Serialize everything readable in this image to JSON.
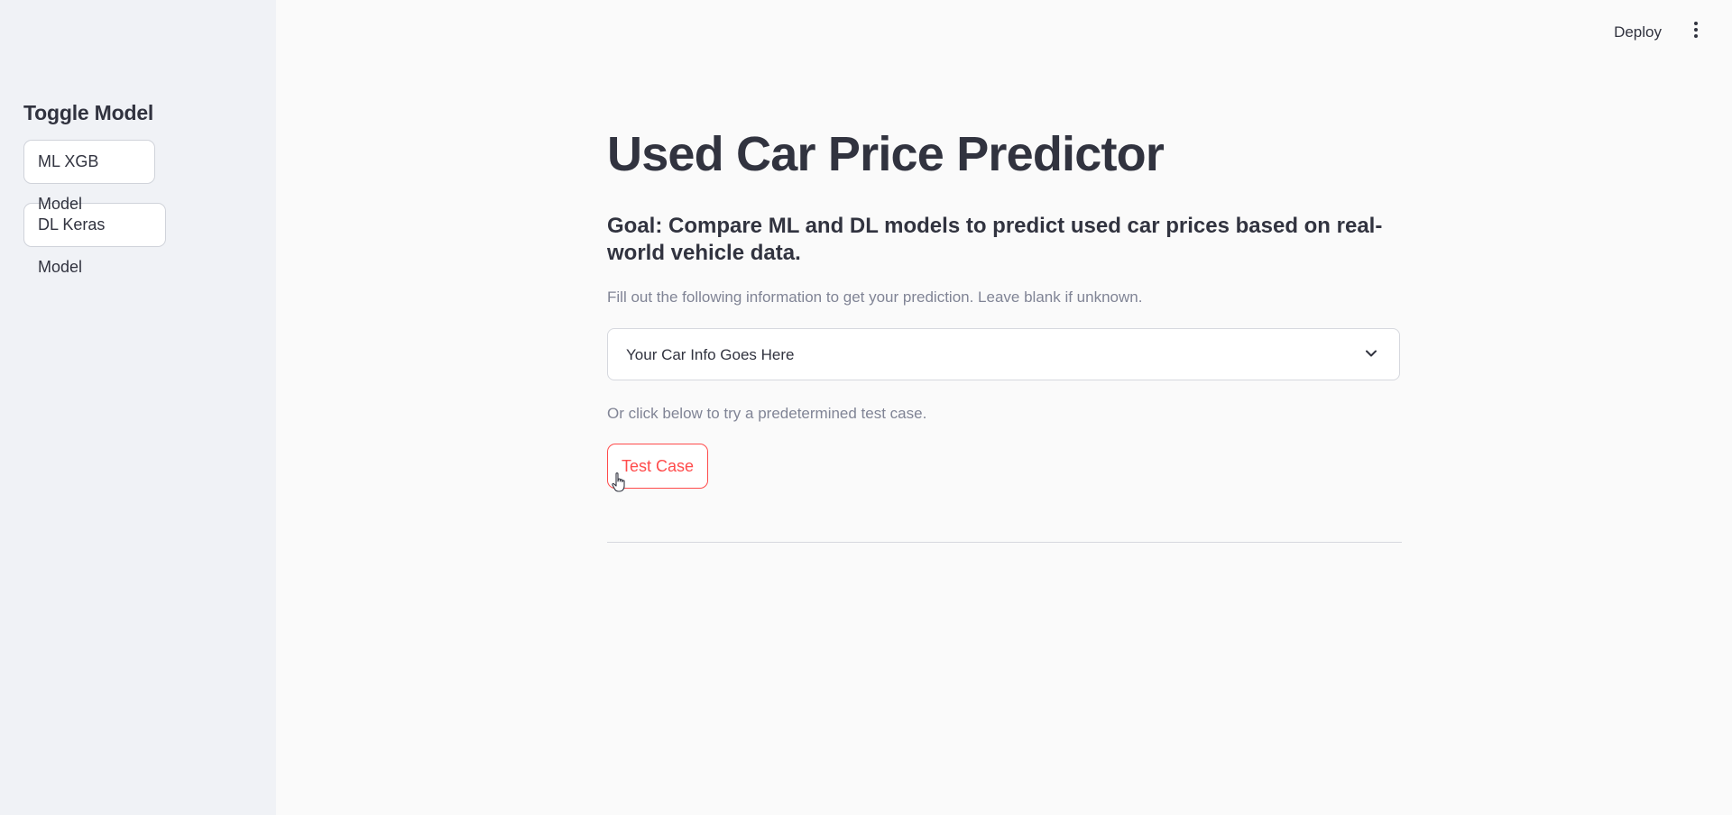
{
  "sidebar": {
    "heading": "Toggle Model",
    "buttons": [
      {
        "label": "ML XGB Model"
      },
      {
        "label": "DL Keras Model"
      }
    ]
  },
  "header": {
    "deploy_label": "Deploy",
    "menu_icon": "kebab-menu-icon"
  },
  "main": {
    "title": "Used Car Price Predictor",
    "goal": "Goal: Compare ML and DL models to predict used car prices based on real-world vehicle data.",
    "instructions": "Fill out the following information to get your prediction. Leave blank if unknown.",
    "expander": {
      "label": "Your Car Info Goes Here",
      "icon": "chevron-down-icon"
    },
    "alt_instructions": "Or click below to try a predetermined test case.",
    "test_button_label": "Test Case"
  },
  "colors": {
    "accent": "#ff4b4b",
    "sidebar_bg": "#f0f2f6",
    "text": "#31333f",
    "muted_text": "#808495"
  }
}
